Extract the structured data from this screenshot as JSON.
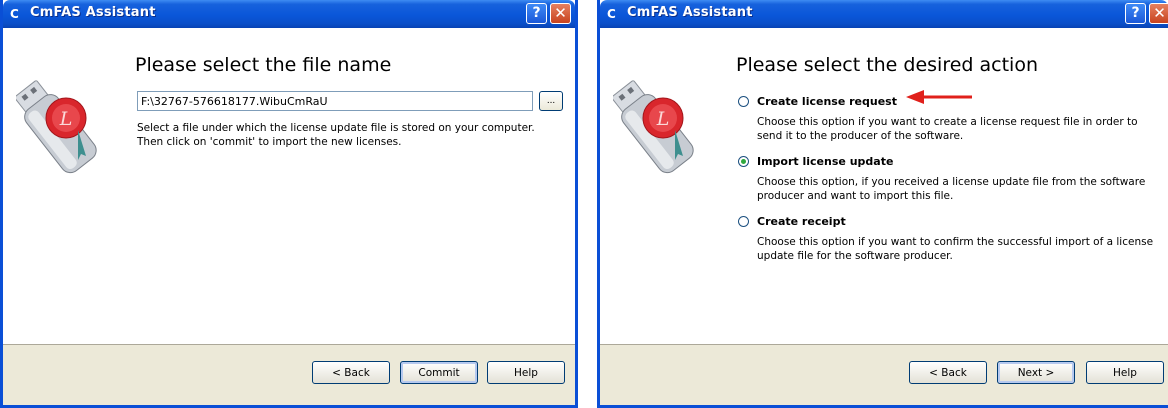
{
  "left_window": {
    "title": "CmFAS Assistant",
    "heading": "Please select the file name",
    "file_input_value": "F:\\32767-576618177.WibuCmRaU",
    "browse_label": "...",
    "description": "Select a file under which the license update file is stored on your computer. Then click on 'commit' to import the new licenses.",
    "buttons": {
      "back": "< Back",
      "commit": "Commit",
      "help": "Help"
    }
  },
  "right_window": {
    "title": "CmFAS Assistant",
    "heading": "Please select the desired action",
    "options": [
      {
        "label": "Create license request",
        "description": "Choose this option if you want to create a license request file in order to send it to the producer of the software.",
        "checked": false
      },
      {
        "label": "Import license update",
        "description": "Choose this option, if you received a license update file from the software producer and want to import this file.",
        "checked": true
      },
      {
        "label": "Create receipt",
        "description": "Choose this option if you want to confirm the successful import of a license update file for the software producer.",
        "checked": false
      }
    ],
    "buttons": {
      "back": "< Back",
      "next": "Next >",
      "help": "Help"
    }
  },
  "colors": {
    "titlebar": "#0a56d9",
    "footer": "#ece9d8",
    "arrow": "#e0201b",
    "seal": "#d9262c",
    "radio_check": "#2fa83e"
  },
  "icons": [
    "app-icon",
    "help-icon",
    "close-icon",
    "usb-key-seal-icon",
    "red-arrow-icon"
  ]
}
